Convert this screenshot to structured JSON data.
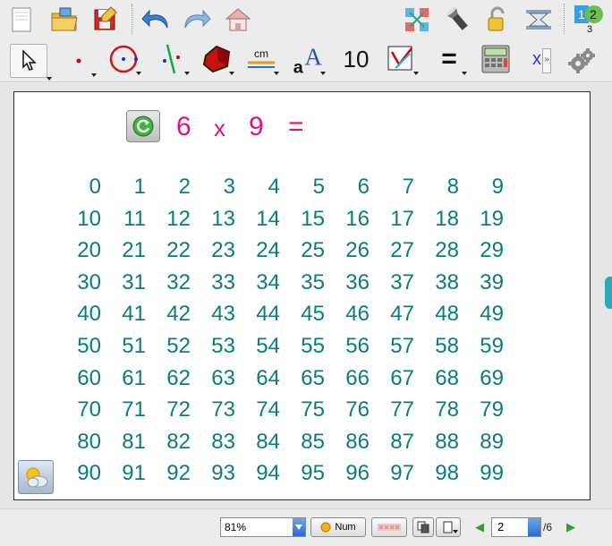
{
  "toolbar_top": {
    "icons": [
      "new-document-icon",
      "open-folder-icon",
      "save-icon",
      "undo-icon",
      "redo-icon",
      "home-icon",
      "network-tool-icon",
      "flashlight-icon",
      "padlock-icon",
      "hourglass-icon",
      "numbering-icon"
    ]
  },
  "toolbar_tools": {
    "label_cm": "cm",
    "label_ten": "10",
    "label_equals": "=",
    "label_x": "x",
    "label_more": "»"
  },
  "equation": {
    "a": "6",
    "op": "x",
    "b": "9",
    "eq": "="
  },
  "number_grid": [
    [
      "0",
      "1",
      "2",
      "3",
      "4",
      "5",
      "6",
      "7",
      "8",
      "9"
    ],
    [
      "10",
      "11",
      "12",
      "13",
      "14",
      "15",
      "16",
      "17",
      "18",
      "19"
    ],
    [
      "20",
      "21",
      "22",
      "23",
      "24",
      "25",
      "26",
      "27",
      "28",
      "29"
    ],
    [
      "30",
      "31",
      "32",
      "33",
      "34",
      "35",
      "36",
      "37",
      "38",
      "39"
    ],
    [
      "40",
      "41",
      "42",
      "43",
      "44",
      "45",
      "46",
      "47",
      "48",
      "49"
    ],
    [
      "50",
      "51",
      "52",
      "53",
      "54",
      "55",
      "56",
      "57",
      "58",
      "59"
    ],
    [
      "60",
      "61",
      "62",
      "63",
      "64",
      "65",
      "66",
      "67",
      "68",
      "69"
    ],
    [
      "70",
      "71",
      "72",
      "73",
      "74",
      "75",
      "76",
      "77",
      "78",
      "79"
    ],
    [
      "80",
      "81",
      "82",
      "83",
      "84",
      "85",
      "86",
      "87",
      "88",
      "89"
    ],
    [
      "90",
      "91",
      "92",
      "93",
      "94",
      "95",
      "96",
      "97",
      "98",
      "99"
    ]
  ],
  "statusbar": {
    "zoom": "81%",
    "num_label": "Num",
    "page_current": "2",
    "page_total": "/6"
  },
  "colors": {
    "equation": "#e0137d",
    "grid_numbers": "#0b7d78",
    "side_tab": "#2fa9b7"
  }
}
